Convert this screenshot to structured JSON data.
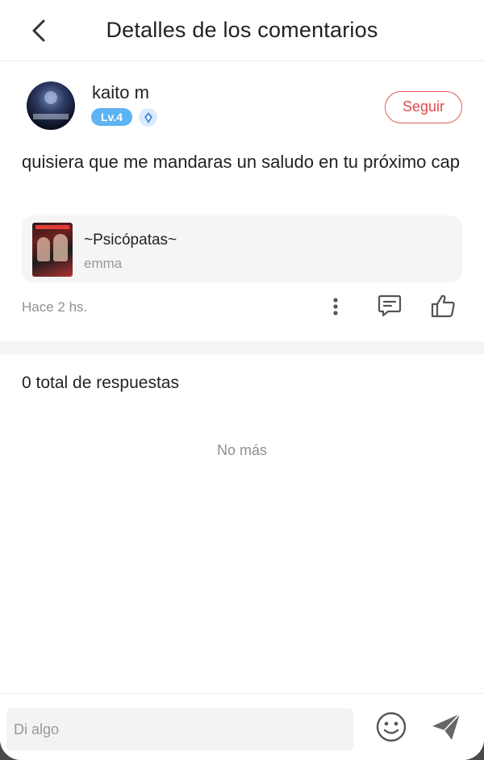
{
  "header": {
    "title": "Detalles de los comentarios",
    "back_icon": "chevron-left-icon"
  },
  "comment": {
    "username": "kaito m",
    "level": "Lv.4",
    "follow_label": "Seguir",
    "text": "quisiera que me mandaras un saludo en tu próximo cap",
    "time": "Hace 2 hs.",
    "book": {
      "title": "~Psicópatas~",
      "author": "emma"
    }
  },
  "replies": {
    "count_label": "0 total de respuestas",
    "no_more": "No más"
  },
  "input": {
    "placeholder": "Di algo"
  },
  "colors": {
    "accent_red": "#e04b4b",
    "level_blue": "#5db4f2",
    "muted_text": "#8f8f8f",
    "card_bg": "#f5f5f5"
  }
}
